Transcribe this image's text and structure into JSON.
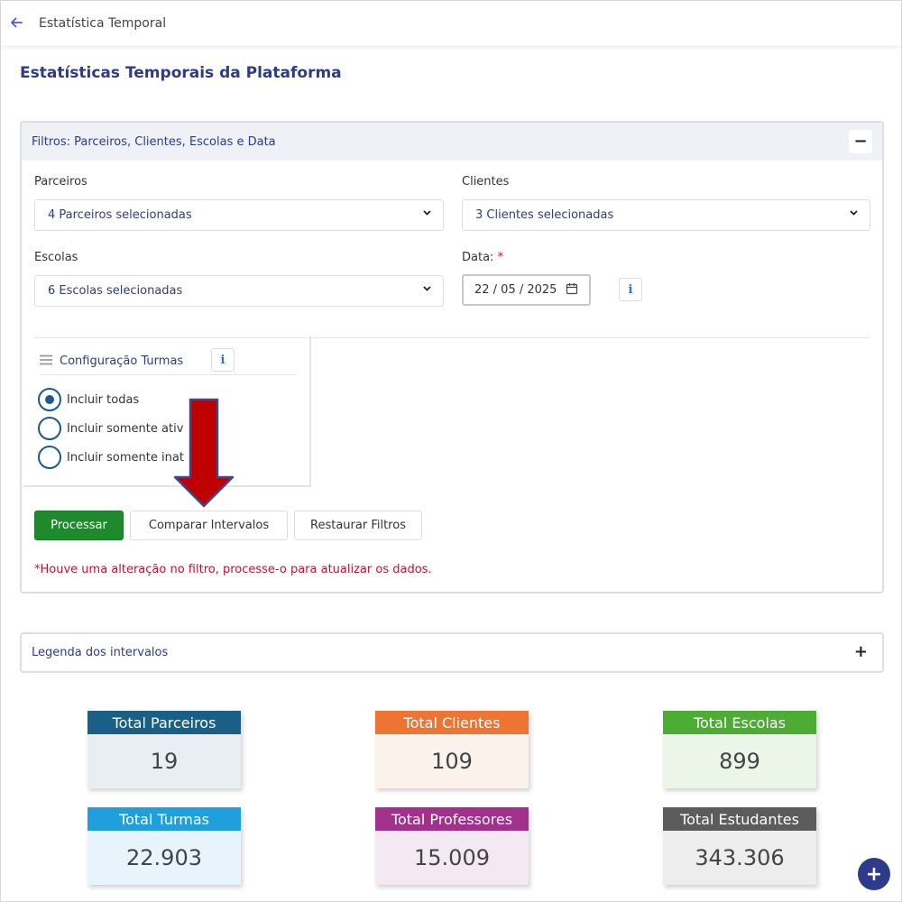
{
  "header": {
    "back_icon": "arrow-left-icon",
    "title": "Estatística Temporal"
  },
  "page_title": "Estatísticas Temporais da Plataforma",
  "filters": {
    "title": "Filtros: Parceiros, Clientes, Escolas e Data",
    "collapse_symbol": "−",
    "parceiros": {
      "label": "Parceiros",
      "value": "4 Parceiros selecionadas"
    },
    "clientes": {
      "label": "Clientes",
      "value": "3 Clientes selecionadas"
    },
    "escolas": {
      "label": "Escolas",
      "value": "6 Escolas selecionadas"
    },
    "data": {
      "label": "Data:",
      "required_mark": "*",
      "value": "22 / 05 / 2025"
    },
    "info_symbol": "i",
    "turmas": {
      "title": "Configuração Turmas",
      "options": [
        {
          "label": "Incluir todas",
          "selected": true
        },
        {
          "label": "Incluir somente ativ",
          "selected": false
        },
        {
          "label": "Incluir somente inat",
          "selected": false
        }
      ]
    },
    "buttons": {
      "process": "Processar",
      "compare": "Comparar Intervalos",
      "reset": "Restaurar Filtros"
    },
    "warning": "*Houve uma alteração no filtro, processe-o para atualizar os dados."
  },
  "legend": {
    "title": "Legenda dos intervalos",
    "expand_symbol": "+"
  },
  "cards": [
    {
      "label": "Total Parceiros",
      "value": "19",
      "head_color": "#1a5f86",
      "body_color": "#e9eef2"
    },
    {
      "label": "Total Clientes",
      "value": "109",
      "head_color": "#ee7434",
      "body_color": "#fcf2ec"
    },
    {
      "label": "Total Escolas",
      "value": "899",
      "head_color": "#4cac33",
      "body_color": "#ebf5e8"
    },
    {
      "label": "Total Turmas",
      "value": "22.903",
      "head_color": "#1fa0dc",
      "body_color": "#e7f4fb"
    },
    {
      "label": "Total Professores",
      "value": "15.009",
      "head_color": "#a2318c",
      "body_color": "#f4e9f2"
    },
    {
      "label": "Total Estudantes",
      "value": "343.306",
      "head_color": "#5c5c5c",
      "body_color": "#ededed"
    }
  ],
  "fab_symbol": "+"
}
